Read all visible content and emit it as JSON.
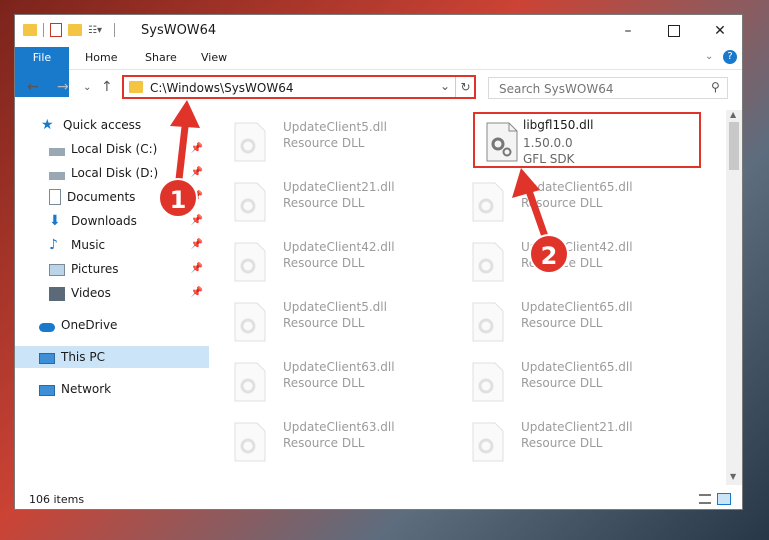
{
  "window": {
    "title": "SysWOW64"
  },
  "ribbon": {
    "tabs": [
      "File",
      "Home",
      "Share",
      "View"
    ]
  },
  "address": {
    "path": "C:\\Windows\\SysWOW64"
  },
  "search": {
    "placeholder": "Search SysWOW64"
  },
  "sidebar": {
    "items": [
      {
        "label": "Quick access"
      },
      {
        "label": "Local Disk (C:)"
      },
      {
        "label": "Local Disk (D:)"
      },
      {
        "label": "Documents"
      },
      {
        "label": "Downloads"
      },
      {
        "label": "Music"
      },
      {
        "label": "Pictures"
      },
      {
        "label": "Videos"
      },
      {
        "label": "OneDrive"
      },
      {
        "label": "This PC"
      },
      {
        "label": "Network"
      }
    ]
  },
  "files": {
    "left": [
      {
        "name": "UpdateClient5.dll",
        "desc": "Resource DLL"
      },
      {
        "name": "UpdateClient21.dll",
        "desc": "Resource DLL"
      },
      {
        "name": "UpdateClient42.dll",
        "desc": "Resource DLL"
      },
      {
        "name": "UpdateClient5.dll",
        "desc": "Resource DLL"
      },
      {
        "name": "UpdateClient63.dll",
        "desc": "Resource DLL"
      },
      {
        "name": "UpdateClient63.dll",
        "desc": "Resource DLL"
      }
    ],
    "highlighted": {
      "name": "libgfl150.dll",
      "version": "1.50.0.0",
      "company": "GFL SDK"
    },
    "right": [
      {
        "name": "UpdateClient65.dll",
        "desc": "Resource DLL"
      },
      {
        "name": "UpdateClient42.dll",
        "desc": "Resource DLL"
      },
      {
        "name": "UpdateClient65.dll",
        "desc": "Resource DLL"
      },
      {
        "name": "UpdateClient65.dll",
        "desc": "Resource DLL"
      },
      {
        "name": "UpdateClient21.dll",
        "desc": "Resource DLL"
      }
    ]
  },
  "status": {
    "count": "106 items"
  },
  "annotations": {
    "step1": "1",
    "step2": "2"
  },
  "colors": {
    "accent": "#1979ca",
    "highlight": "#e0342b"
  }
}
